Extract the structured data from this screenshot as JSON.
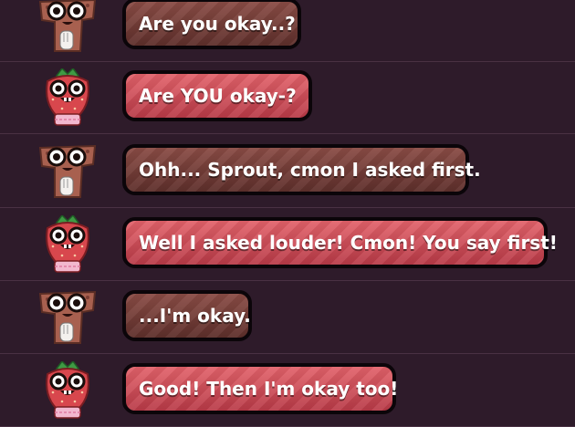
{
  "messages": [
    {
      "speaker": "cracker",
      "text": "Are you okay..?"
    },
    {
      "speaker": "strawberry",
      "text": "Are YOU okay-?"
    },
    {
      "speaker": "cracker",
      "text": "Ohh... Sprout, cmon I asked first."
    },
    {
      "speaker": "strawberry",
      "text": "Well I asked louder! Cmon! You say first!"
    },
    {
      "speaker": "cracker",
      "text": "...I'm okay."
    },
    {
      "speaker": "strawberry",
      "text": "Good! Then I'm okay too!"
    }
  ],
  "colors": {
    "background": "#2e1b2a",
    "bubble_cracker": "#6e3a35",
    "bubble_strawberry": "#d24e5a",
    "bubble_border": "#0b0509",
    "text": "#ffffff"
  },
  "icons": {
    "cracker": "cracker-character-icon",
    "strawberry": "strawberry-character-icon"
  }
}
